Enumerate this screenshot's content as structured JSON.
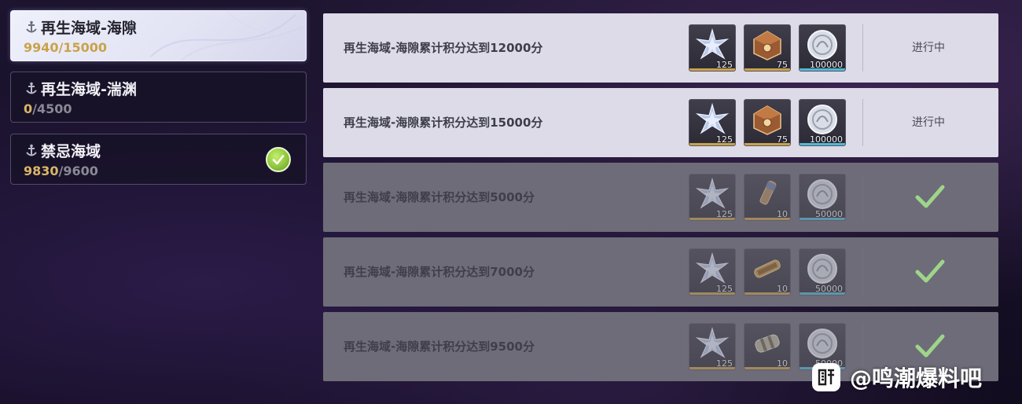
{
  "regions": [
    {
      "name": "再生海域-海隙",
      "current": "9940",
      "sep": "/",
      "total": "15000",
      "active": true,
      "complete": false
    },
    {
      "name": "再生海域-湍渊",
      "current": "0",
      "sep": "/",
      "total": "4500",
      "active": false,
      "complete": false
    },
    {
      "name": "禁忌海域",
      "current": "9830",
      "sep": "/",
      "total": "9600",
      "active": false,
      "complete": true
    }
  ],
  "tasks": [
    {
      "label": "再生海域-海隙累计积分达到12000分",
      "state": "in_progress",
      "status_text": "进行中",
      "rewards": [
        {
          "icon": "star-crystal-icon",
          "qty": "125"
        },
        {
          "icon": "treasure-chest-icon",
          "qty": "75"
        },
        {
          "icon": "shell-coin-icon",
          "qty": "100000"
        }
      ]
    },
    {
      "label": "再生海域-海隙累计积分达到15000分",
      "state": "in_progress",
      "status_text": "进行中",
      "rewards": [
        {
          "icon": "star-crystal-icon",
          "qty": "125"
        },
        {
          "icon": "treasure-chest-icon",
          "qty": "75"
        },
        {
          "icon": "shell-coin-icon",
          "qty": "100000"
        }
      ]
    },
    {
      "label": "再生海域-海隙累计积分达到5000分",
      "state": "done",
      "status_text": "",
      "rewards": [
        {
          "icon": "star-crystal-icon",
          "qty": "125"
        },
        {
          "icon": "tool-item-icon",
          "qty": "10"
        },
        {
          "icon": "shell-coin-icon",
          "qty": "50000"
        }
      ]
    },
    {
      "label": "再生海域-海隙累计积分达到7000分",
      "state": "done",
      "status_text": "",
      "rewards": [
        {
          "icon": "star-crystal-icon",
          "qty": "125"
        },
        {
          "icon": "scroll-item-icon",
          "qty": "10"
        },
        {
          "icon": "shell-coin-icon",
          "qty": "50000"
        }
      ]
    },
    {
      "label": "再生海域-海隙累计积分达到9500分",
      "state": "done",
      "status_text": "",
      "rewards": [
        {
          "icon": "star-crystal-icon",
          "qty": "125"
        },
        {
          "icon": "canister-item-icon",
          "qty": "10"
        },
        {
          "icon": "shell-coin-icon",
          "qty": "50000"
        }
      ]
    }
  ],
  "watermark": {
    "text": "@鸣潮爆料吧"
  },
  "colors": {
    "accent_gold": "#c9a24a",
    "check_green": "#8bc23b",
    "row_active": "#dcdbe7",
    "row_done": "#6e6c78"
  }
}
